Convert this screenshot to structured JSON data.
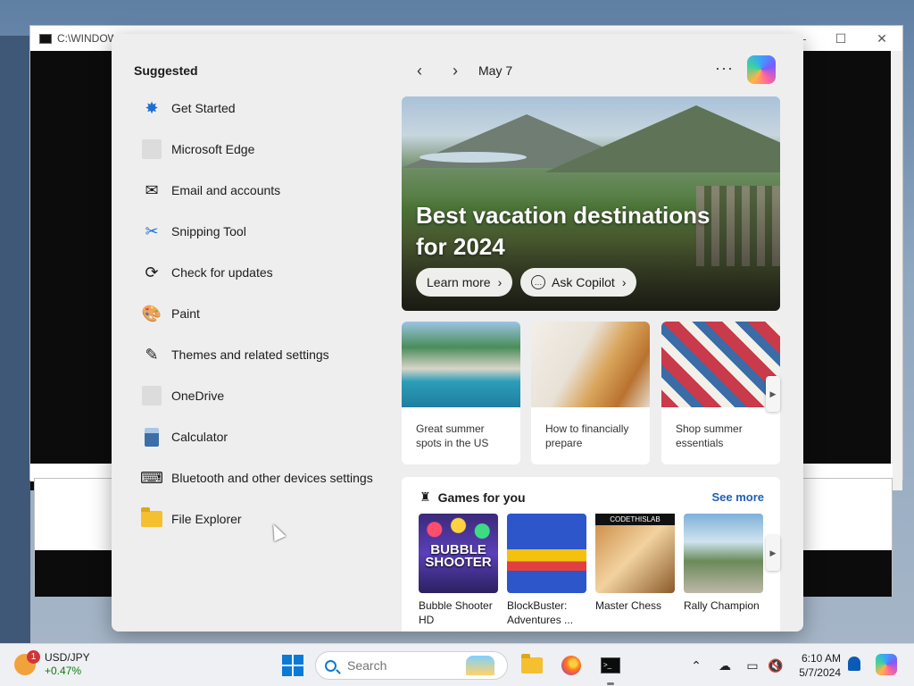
{
  "background_window": {
    "title": "C:\\WINDOWS"
  },
  "panel": {
    "suggested_title": "Suggested",
    "suggested": [
      {
        "label": "Get Started",
        "icon": "get-started-icon"
      },
      {
        "label": "Microsoft Edge",
        "icon": "edge-icon"
      },
      {
        "label": "Email and accounts",
        "icon": "mail-icon"
      },
      {
        "label": "Snipping Tool",
        "icon": "scissors-icon"
      },
      {
        "label": "Check for updates",
        "icon": "refresh-icon"
      },
      {
        "label": "Paint",
        "icon": "palette-icon"
      },
      {
        "label": "Themes and related settings",
        "icon": "brush-icon"
      },
      {
        "label": "OneDrive",
        "icon": "onedrive-icon"
      },
      {
        "label": "Calculator",
        "icon": "calculator-icon"
      },
      {
        "label": "Bluetooth and other devices settings",
        "icon": "devices-icon"
      },
      {
        "label": "File Explorer",
        "icon": "folder-icon"
      }
    ],
    "date": "May 7",
    "more": "···",
    "hero": {
      "title": "Best vacation destinations for 2024",
      "learn_more": "Learn more",
      "ask_copilot": "Ask Copilot"
    },
    "cards": [
      {
        "caption": "Great summer spots in the US"
      },
      {
        "caption": "How to financially prepare"
      },
      {
        "caption": "Shop summer essentials"
      }
    ],
    "games": {
      "title": "Games for you",
      "see_more": "See more",
      "items": [
        {
          "name": "Bubble Shooter HD",
          "art_text": "BUBBLE SHOOTER"
        },
        {
          "name": "BlockBuster: Adventures ..."
        },
        {
          "name": "Master Chess",
          "art_text": "CODETHISLAB"
        },
        {
          "name": "Rally Champion"
        }
      ]
    }
  },
  "taskbar": {
    "stock_symbol": "USD/JPY",
    "stock_change": "+0.47%",
    "stock_badge": "1",
    "search_placeholder": "Search",
    "time": "6:10 AM",
    "date": "5/7/2024"
  },
  "colors": {
    "accent": "#0a7ad8",
    "see_more_link": "#1f5eb8",
    "stock_positive": "#0f7b0f",
    "badge": "#d13438"
  }
}
